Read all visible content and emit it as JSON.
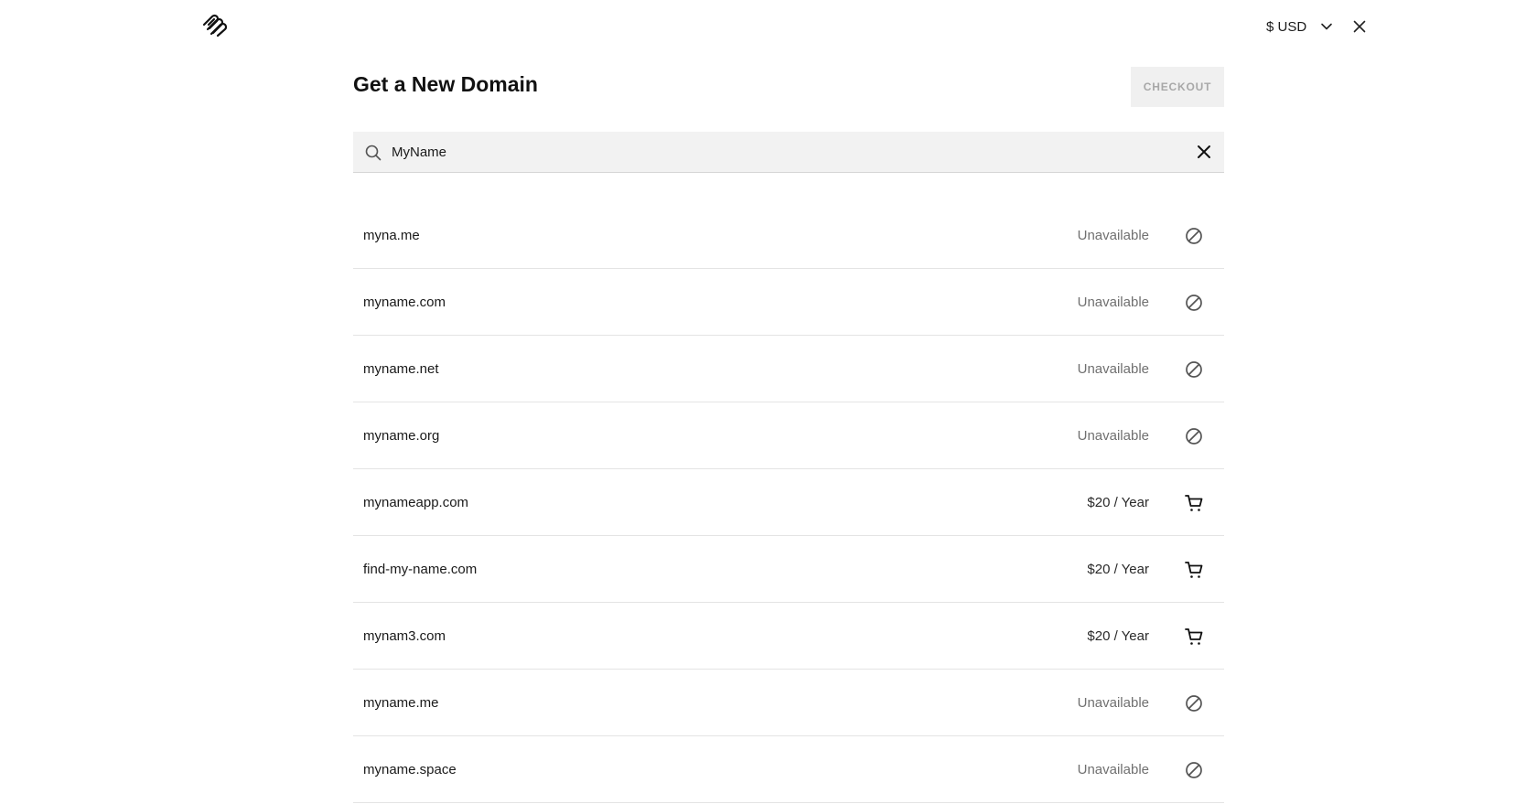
{
  "header": {
    "logo_icon": "squarespace-logo-icon",
    "currency_label": "$ USD",
    "currency_icon": "chevron-down-icon",
    "close_icon": "close-icon"
  },
  "page": {
    "title": "Get a New Domain",
    "checkout_label": "CHECKOUT"
  },
  "search": {
    "icon": "search-icon",
    "value": "MyName",
    "clear_icon": "clear-icon"
  },
  "results": [
    {
      "domain": "myna.me",
      "status": "Unavailable",
      "available": false,
      "icon": "unavailable-icon"
    },
    {
      "domain": "myname.com",
      "status": "Unavailable",
      "available": false,
      "icon": "unavailable-icon"
    },
    {
      "domain": "myname.net",
      "status": "Unavailable",
      "available": false,
      "icon": "unavailable-icon"
    },
    {
      "domain": "myname.org",
      "status": "Unavailable",
      "available": false,
      "icon": "unavailable-icon"
    },
    {
      "domain": "mynameapp.com",
      "status": "$20 / Year",
      "available": true,
      "icon": "cart-icon"
    },
    {
      "domain": "find-my-name.com",
      "status": "$20 / Year",
      "available": true,
      "icon": "cart-icon"
    },
    {
      "domain": "mynam3.com",
      "status": "$20 / Year",
      "available": true,
      "icon": "cart-icon"
    },
    {
      "domain": "myname.me",
      "status": "Unavailable",
      "available": false,
      "icon": "unavailable-icon"
    },
    {
      "domain": "myname.space",
      "status": "Unavailable",
      "available": false,
      "icon": "unavailable-icon"
    }
  ],
  "colors": {
    "unavailable_text": "#707070",
    "checkout_disabled_bg": "#f0f0f0",
    "search_bg": "#f2f2f2"
  }
}
